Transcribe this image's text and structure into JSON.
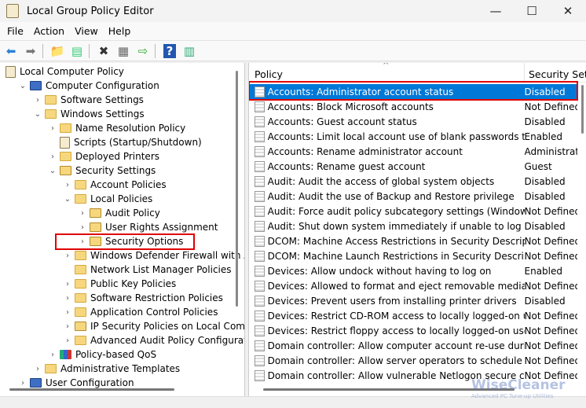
{
  "window": {
    "title": "Local Group Policy Editor",
    "minimize": "—",
    "maximize": "☐",
    "close": "✕"
  },
  "menu": [
    "File",
    "Action",
    "View",
    "Help"
  ],
  "toolbar": [
    {
      "icon": "back-arrow-icon",
      "glyph": "⬅",
      "color": "#2a7fd4"
    },
    {
      "icon": "forward-arrow-icon",
      "glyph": "➡",
      "color": "#777"
    },
    {
      "sep": true
    },
    {
      "icon": "up-folder-icon",
      "glyph": "📁",
      "color": "#d6a93a"
    },
    {
      "icon": "show-hide-tree-icon",
      "glyph": "▤",
      "color": "#3c7"
    },
    {
      "sep": true
    },
    {
      "icon": "delete-icon",
      "glyph": "✖",
      "color": "#333"
    },
    {
      "icon": "properties-icon",
      "glyph": "▦",
      "color": "#666"
    },
    {
      "icon": "export-list-icon",
      "glyph": "⇨",
      "color": "#3a3"
    },
    {
      "sep": true
    },
    {
      "icon": "help-icon",
      "glyph": "?",
      "color": "#fff"
    },
    {
      "icon": "show-action-pane-icon",
      "glyph": "▥",
      "color": "#3a7"
    }
  ],
  "tree": [
    {
      "label": "Local Computer Policy",
      "level": 0,
      "chevron": "",
      "icon": "doc"
    },
    {
      "label": "Computer Configuration",
      "level": 1,
      "chevron": "expanded",
      "icon": "comp"
    },
    {
      "label": "Software Settings",
      "level": 2,
      "chevron": "collapsed",
      "icon": "folder"
    },
    {
      "label": "Windows Settings",
      "level": 2,
      "chevron": "expanded",
      "icon": "folder"
    },
    {
      "label": "Name Resolution Policy",
      "level": 3,
      "chevron": "collapsed",
      "icon": "folder"
    },
    {
      "label": "Scripts (Startup/Shutdown)",
      "level": 3,
      "chevron": "",
      "icon": "doc"
    },
    {
      "label": "Deployed Printers",
      "level": 3,
      "chevron": "collapsed",
      "icon": "folder"
    },
    {
      "label": "Security Settings",
      "level": 3,
      "chevron": "expanded",
      "icon": "sec"
    },
    {
      "label": "Account Policies",
      "level": 4,
      "chevron": "collapsed",
      "icon": "folder"
    },
    {
      "label": "Local Policies",
      "level": 4,
      "chevron": "expanded",
      "icon": "folder"
    },
    {
      "label": "Audit Policy",
      "level": 5,
      "chevron": "collapsed",
      "icon": "sec"
    },
    {
      "label": "User Rights Assignment",
      "level": 5,
      "chevron": "collapsed",
      "icon": "sec"
    },
    {
      "label": "Security Options",
      "level": 5,
      "chevron": "collapsed",
      "icon": "sec",
      "highlighted": true
    },
    {
      "label": "Windows Defender Firewall with Adv",
      "level": 4,
      "chevron": "collapsed",
      "icon": "folder"
    },
    {
      "label": "Network List Manager Policies",
      "level": 4,
      "chevron": "",
      "icon": "folder"
    },
    {
      "label": "Public Key Policies",
      "level": 4,
      "chevron": "collapsed",
      "icon": "folder"
    },
    {
      "label": "Software Restriction Policies",
      "level": 4,
      "chevron": "collapsed",
      "icon": "folder"
    },
    {
      "label": "Application Control Policies",
      "level": 4,
      "chevron": "collapsed",
      "icon": "folder"
    },
    {
      "label": "IP Security Policies on Local Comput",
      "level": 4,
      "chevron": "collapsed",
      "icon": "sec"
    },
    {
      "label": "Advanced Audit Policy Configuration",
      "level": 4,
      "chevron": "collapsed",
      "icon": "folder"
    },
    {
      "label": "Policy-based QoS",
      "level": 3,
      "chevron": "collapsed",
      "icon": "qos"
    },
    {
      "label": "Administrative Templates",
      "level": 2,
      "chevron": "collapsed",
      "icon": "folder"
    },
    {
      "label": "User Configuration",
      "level": 1,
      "chevron": "collapsed",
      "icon": "comp"
    }
  ],
  "list": {
    "headers": {
      "policy": "Policy",
      "setting": "Security Set"
    },
    "rows": [
      {
        "policy": "Accounts: Administrator account status",
        "setting": "Disabled",
        "selected": true
      },
      {
        "policy": "Accounts: Block Microsoft accounts",
        "setting": "Not Defined"
      },
      {
        "policy": "Accounts: Guest account status",
        "setting": "Disabled"
      },
      {
        "policy": "Accounts: Limit local account use of blank passwords to co...",
        "setting": "Enabled"
      },
      {
        "policy": "Accounts: Rename administrator account",
        "setting": "Administrator"
      },
      {
        "policy": "Accounts: Rename guest account",
        "setting": "Guest"
      },
      {
        "policy": "Audit: Audit the access of global system objects",
        "setting": "Disabled"
      },
      {
        "policy": "Audit: Audit the use of Backup and Restore privilege",
        "setting": "Disabled"
      },
      {
        "policy": "Audit: Force audit policy subcategory settings (Windows Vis...",
        "setting": "Not Defined"
      },
      {
        "policy": "Audit: Shut down system immediately if unable to log secur...",
        "setting": "Disabled"
      },
      {
        "policy": "DCOM: Machine Access Restrictions in Security Descriptor D...",
        "setting": "Not Defined"
      },
      {
        "policy": "DCOM: Machine Launch Restrictions in Security Descriptor ...",
        "setting": "Not Defined"
      },
      {
        "policy": "Devices: Allow undock without having to log on",
        "setting": "Enabled"
      },
      {
        "policy": "Devices: Allowed to format and eject removable media",
        "setting": "Not Defined"
      },
      {
        "policy": "Devices: Prevent users from installing printer drivers",
        "setting": "Disabled"
      },
      {
        "policy": "Devices: Restrict CD-ROM access to locally logged-on user ...",
        "setting": "Not Defined"
      },
      {
        "policy": "Devices: Restrict floppy access to locally logged-on user only",
        "setting": "Not Defined"
      },
      {
        "policy": "Domain controller: Allow computer account re-use during d...",
        "setting": "Not Defined"
      },
      {
        "policy": "Domain controller: Allow server operators to schedule tasks",
        "setting": "Not Defined"
      },
      {
        "policy": "Domain controller: Allow vulnerable Netlogon secure chann...",
        "setting": "Not Defined"
      }
    ]
  },
  "watermark": {
    "brand": "WiseCleaner",
    "tagline": "Advanced PC Tune-up Utilities"
  },
  "colors": {
    "selection": "#0078d7",
    "highlight_box": "#e00000"
  }
}
